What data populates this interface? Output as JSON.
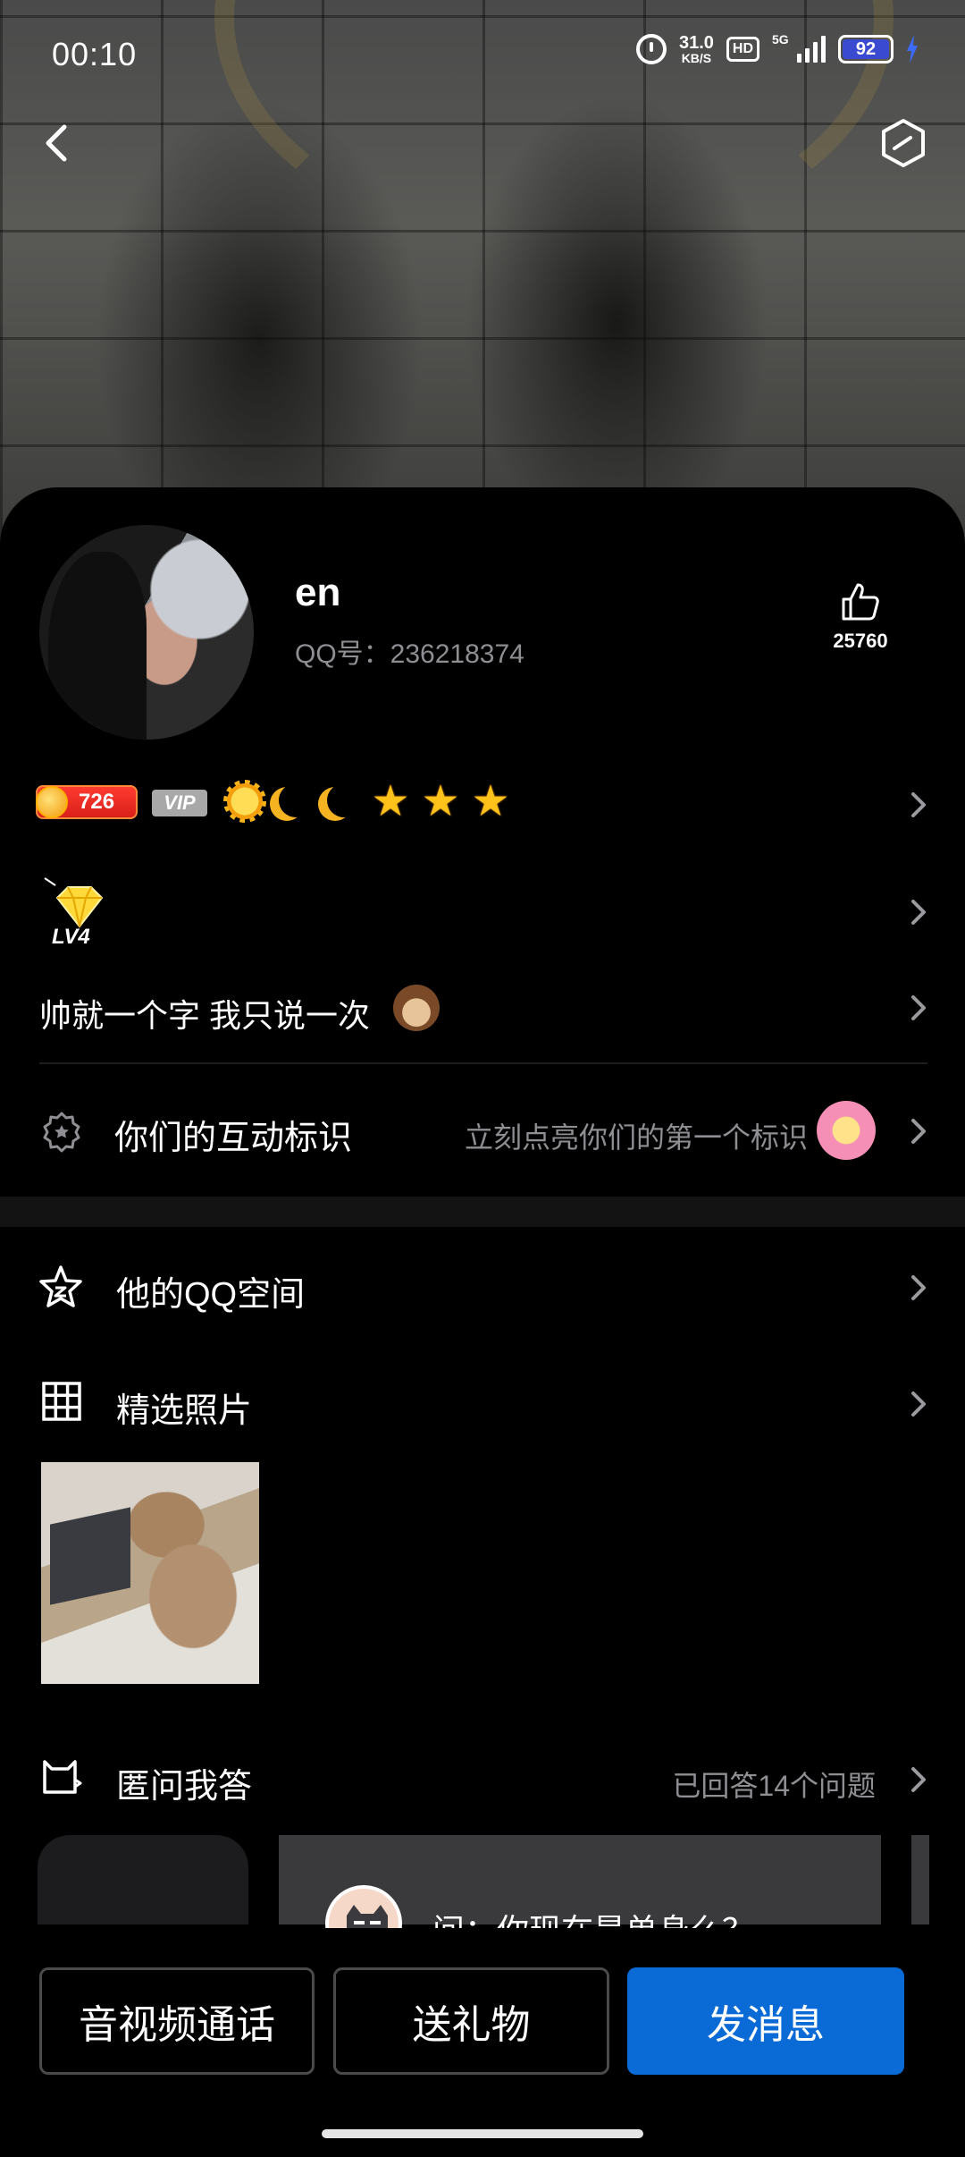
{
  "status_bar": {
    "time": "00:10",
    "net_speed_value": "31.0",
    "net_speed_unit": "KB/S",
    "hd": "HD",
    "network": "5G",
    "battery": "92"
  },
  "profile": {
    "username": "en",
    "qq_number": "QQ号：236218374",
    "likes": "25760",
    "level": "726",
    "vip": "VIP",
    "diamond_level": "LV4",
    "signature": "帅就一个字  我只说一次"
  },
  "interaction": {
    "label": "你们的互动标识",
    "hint": "立刻点亮你们的第一个标识"
  },
  "menu": {
    "qzone": "他的QQ空间",
    "photos": "精选照片",
    "qa": "匿问我答",
    "qa_hint": "已回答14个问题"
  },
  "qa_card": {
    "question": "问：你现在是单身么？"
  },
  "actions": {
    "call": "音视频通话",
    "gift": "送礼物",
    "send": "发消息"
  },
  "colors": {
    "accent_blue": "#0a6ad6",
    "background": "#000000",
    "secondary_text": "#8e8e93"
  }
}
